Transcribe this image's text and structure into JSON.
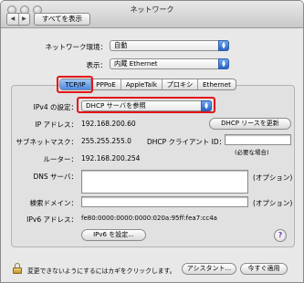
{
  "window": {
    "title": "ネットワーク"
  },
  "toolbar": {
    "back": "◀",
    "forward": "▶",
    "show_all_label": "すべてを表示"
  },
  "location": {
    "label": "ネットワーク環境：",
    "value": "自動"
  },
  "show": {
    "label": "表示：",
    "value": "内蔵 Ethernet"
  },
  "tabs": [
    {
      "label": "TCP/IP",
      "selected": true
    },
    {
      "label": "PPPoE",
      "selected": false
    },
    {
      "label": "AppleTalk",
      "selected": false
    },
    {
      "label": "プロキシ",
      "selected": false
    },
    {
      "label": "Ethernet",
      "selected": false
    }
  ],
  "ipv4": {
    "label": "IPv4 の設定：",
    "value": "DHCP サーバを参照"
  },
  "ip_address": {
    "label": "IP アドレス：",
    "value": "192.168.200.60"
  },
  "renew_button": "DHCP リースを更新",
  "subnet": {
    "label": "サブネットマスク：",
    "value": "255.255.255.0"
  },
  "client_id": {
    "label": "DHCP クライアント ID：",
    "value": "",
    "hint": "(必要な場合)"
  },
  "router": {
    "label": "ルーター：",
    "value": "192.168.200.254"
  },
  "dns": {
    "label": "DNS サーバ：",
    "value": "",
    "note": "(オプション)"
  },
  "search_domains": {
    "label": "検索ドメイン：",
    "value": "",
    "note": "(オプション)"
  },
  "ipv6_address": {
    "label": "IPv6 アドレス：",
    "value": "fe80:0000:0000:0000:020a:95ff:fea7:cc4a"
  },
  "ipv6_button": "IPv6 を設定...",
  "help_label": "?",
  "footer": {
    "lock_text": "変更できないようにするにはカギをクリックします。",
    "assistant_label": "アシスタント...",
    "apply_label": "今すぐ適用"
  },
  "highlight_color": "#e3151a",
  "accent_color": "#3a78d8"
}
